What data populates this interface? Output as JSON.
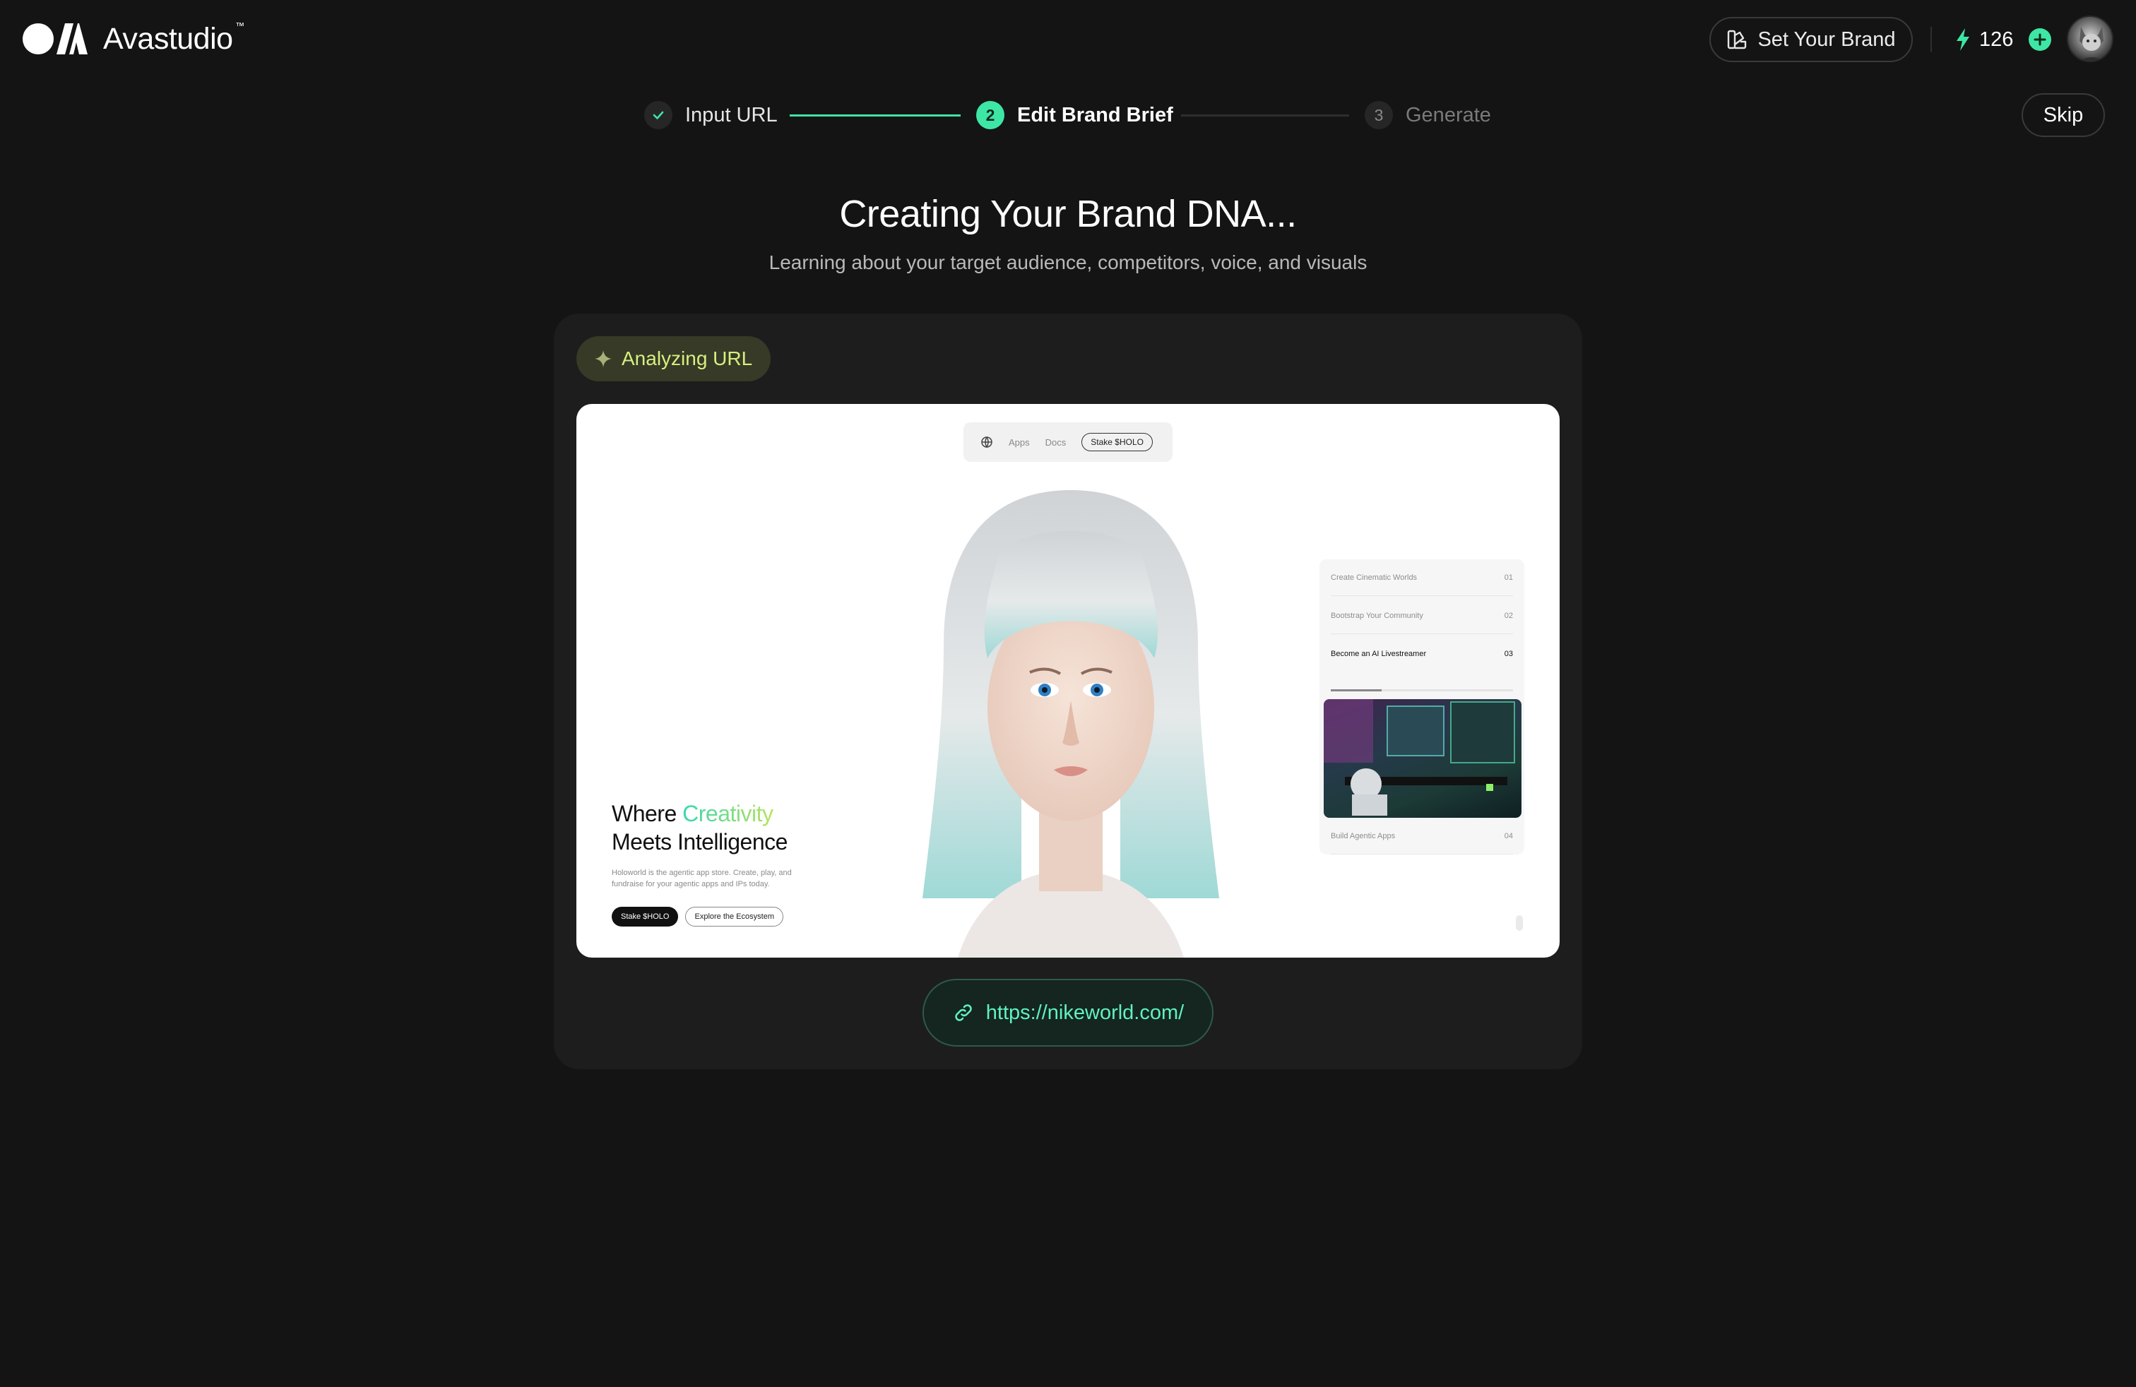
{
  "app": {
    "logo_text": "Avastudio",
    "logo_tm": "™"
  },
  "header": {
    "set_brand_label": "Set Your Brand",
    "credits": "126",
    "accent_color": "#3ee6a5"
  },
  "stepper": {
    "steps": [
      {
        "number": "1",
        "label": "Input URL",
        "status": "completed"
      },
      {
        "number": "2",
        "label": "Edit Brand Brief",
        "status": "active"
      },
      {
        "number": "3",
        "label": "Generate",
        "status": "pending"
      }
    ],
    "skip_label": "Skip"
  },
  "main": {
    "title": "Creating Your Brand DNA...",
    "subtitle": "Learning about your target audience, competitors, voice, and visuals",
    "status_badge": "Analyzing URL",
    "url": "https://nikeworld.com/"
  },
  "preview": {
    "nav": {
      "items": [
        "Apps",
        "Docs"
      ],
      "cta": "Stake $HOLO"
    },
    "hero": {
      "headline_part1": "Where ",
      "headline_accent": "Creativity",
      "headline_part2": "Meets Intelligence",
      "description": "Holoworld is the agentic app store. Create, play, and fundraise for your agentic apps and IPs today.",
      "primary_button": "Stake $HOLO",
      "secondary_button": "Explore the Ecosystem"
    },
    "side_list": [
      {
        "label": "Create Cinematic Worlds",
        "number": "01"
      },
      {
        "label": "Bootstrap Your Community",
        "number": "02"
      },
      {
        "label": "Become an AI Livestreamer",
        "number": "03"
      },
      {
        "label": "Build Agentic Apps",
        "number": "04"
      }
    ]
  }
}
